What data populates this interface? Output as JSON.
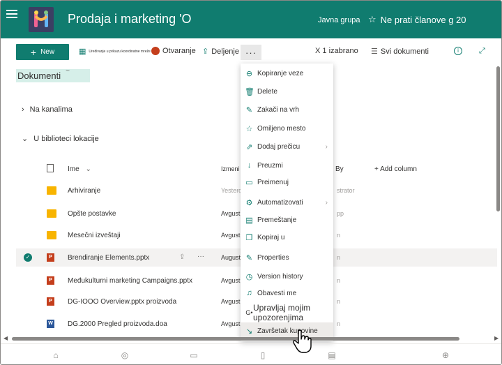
{
  "header": {
    "site_title": "Prodaja i marketing 'O",
    "group_type": "Javna grupa",
    "follow_label": "Ne prati članove g 20"
  },
  "commandbar": {
    "new_label": "New",
    "grid_label": "Uređivanje u prikazu koordinatne mreže",
    "open_label": "Otvaranje",
    "share_label": "Deljenje",
    "more_label": "···",
    "selected_count": "X 1 izabrano",
    "view_label": "Svi dokumenti"
  },
  "library": {
    "title": "Dokumenti",
    "title_badge": "˜˜",
    "channels_label": "Na kanalima",
    "site_library_label": "U biblioteci lokacije"
  },
  "table": {
    "col_name": "Ime",
    "col_modified": "Izmeni",
    "col_by": "By",
    "add_column": "+ Add column",
    "rows": [
      {
        "name": "Arhiviranje",
        "modified": "Yesterd",
        "by": "strator",
        "type": "folder"
      },
      {
        "name": "Opšte postavke",
        "modified": "Avgust",
        "by": "pp",
        "type": "folder"
      },
      {
        "name": "Mesečni izveštaji",
        "modified": "Avgust",
        "by": "n",
        "type": "folder"
      },
      {
        "name": "Brendiranje Elements.pptx",
        "modified": "August",
        "by": "n",
        "type": "ppt",
        "selected": true
      },
      {
        "name": "Međukulturni marketing Campaigns.pptx",
        "modified": "Avgust",
        "by": "n",
        "type": "ppt"
      },
      {
        "name": "DG-IOOO Overview.pptx proizvoda",
        "modified": "Avgust",
        "by": "n",
        "type": "ppt"
      },
      {
        "name": "DG.2000 Pregled proizvoda.doa",
        "modified": "Avgust",
        "by": "n",
        "type": "word"
      }
    ]
  },
  "menu": {
    "items": [
      {
        "label": "Kopiranje veze",
        "icon": "link-icon",
        "glyph": "⊖"
      },
      {
        "label": "Delete",
        "icon": "trash-icon",
        "glyph": "🗑"
      },
      {
        "label": "Zakači na vrh",
        "icon": "pin-icon",
        "glyph": "✎"
      },
      {
        "label": "Omiljeno mesto",
        "icon": "star-icon",
        "glyph": "☆"
      },
      {
        "label": "Dodaj prečicu",
        "icon": "shortcut-icon",
        "glyph": "⇗",
        "chevron": "›"
      },
      {
        "label": "Preuzmi",
        "icon": "download-icon",
        "glyph": "↓"
      },
      {
        "label": "Preimenuj",
        "icon": "rename-icon",
        "glyph": "▭"
      },
      {
        "label": "Automatizovati",
        "icon": "automate-icon",
        "glyph": "⚙",
        "chevron": "›"
      },
      {
        "label": "Premeštanje",
        "icon": "move-icon",
        "glyph": "▤"
      },
      {
        "label": "Kopiraj u",
        "icon": "copy-icon",
        "glyph": "❐"
      },
      {
        "label": "Properties",
        "icon": "pencil-icon",
        "glyph": "✎"
      },
      {
        "label": "Version history",
        "icon": "history-icon",
        "glyph": "◷"
      },
      {
        "label": "Obavesti me",
        "icon": "bell-icon",
        "glyph": "♫"
      },
      {
        "label": "Upravljaj mojim upozorenjima",
        "icon": "alerts-icon",
        "glyph": "G•"
      },
      {
        "label": "Završetak kupovine",
        "icon": "checkout-icon",
        "glyph": "↘"
      }
    ]
  },
  "colors": {
    "brand": "#107c6f",
    "menu_icon": "#107c6f"
  }
}
